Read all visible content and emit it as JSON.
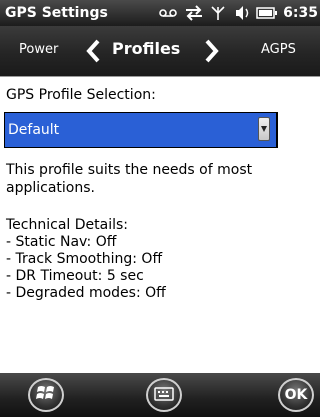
{
  "status_bar": {
    "app_title": "GPS Settings",
    "clock": "6:35",
    "icons": [
      "voicemail-icon",
      "data-sync-icon",
      "signal-icon",
      "volume-icon",
      "battery-icon"
    ]
  },
  "tabs": {
    "previous": "Power",
    "current": "Profiles",
    "next": "AGPS"
  },
  "content": {
    "selection_label": "GPS Profile Selection:",
    "selected_profile": "Default",
    "description": "This profile suits the needs of most applications.",
    "details_heading": "Technical Details:",
    "details": [
      "- Static Nav: Off",
      "- Track Smoothing: Off",
      "- DR Timeout: 5 sec",
      "- Degraded modes: Off"
    ]
  },
  "bottom_bar": {
    "ok_label": "OK"
  }
}
